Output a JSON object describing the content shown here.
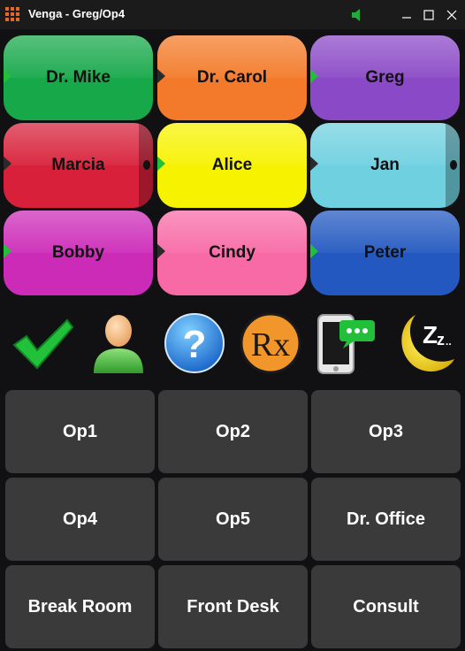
{
  "window": {
    "title": "Venga - Greg/Op4"
  },
  "people": [
    {
      "name": "Dr. Mike",
      "color": "#17a84a",
      "indicator": "green"
    },
    {
      "name": "Dr. Carol",
      "color": "#f37a2a",
      "indicator": "dark"
    },
    {
      "name": "Greg",
      "color": "#8a49c6",
      "indicator": "green"
    },
    {
      "name": "Marcia",
      "color": "#d8203a",
      "indicator": "dark"
    },
    {
      "name": "Alice",
      "color": "#f7f200",
      "indicator": "green"
    },
    {
      "name": "Jan",
      "color": "#6fd0e0",
      "indicator": "dark"
    },
    {
      "name": "Bobby",
      "color": "#cc2bb8",
      "indicator": "green"
    },
    {
      "name": "Cindy",
      "color": "#f86aa6",
      "indicator": "dark"
    },
    {
      "name": "Peter",
      "color": "#2258c0",
      "indicator": "green"
    }
  ],
  "status_icons": [
    {
      "icon": "checkmark-icon"
    },
    {
      "icon": "person-icon"
    },
    {
      "icon": "question-icon"
    },
    {
      "icon": "rx-icon"
    },
    {
      "icon": "phone-message-icon"
    },
    {
      "icon": "sleep-moon-icon"
    }
  ],
  "rooms": [
    "Op1",
    "Op2",
    "Op3",
    "Op4",
    "Op5",
    "Dr. Office",
    "Break Room",
    "Front Desk",
    "Consult"
  ]
}
